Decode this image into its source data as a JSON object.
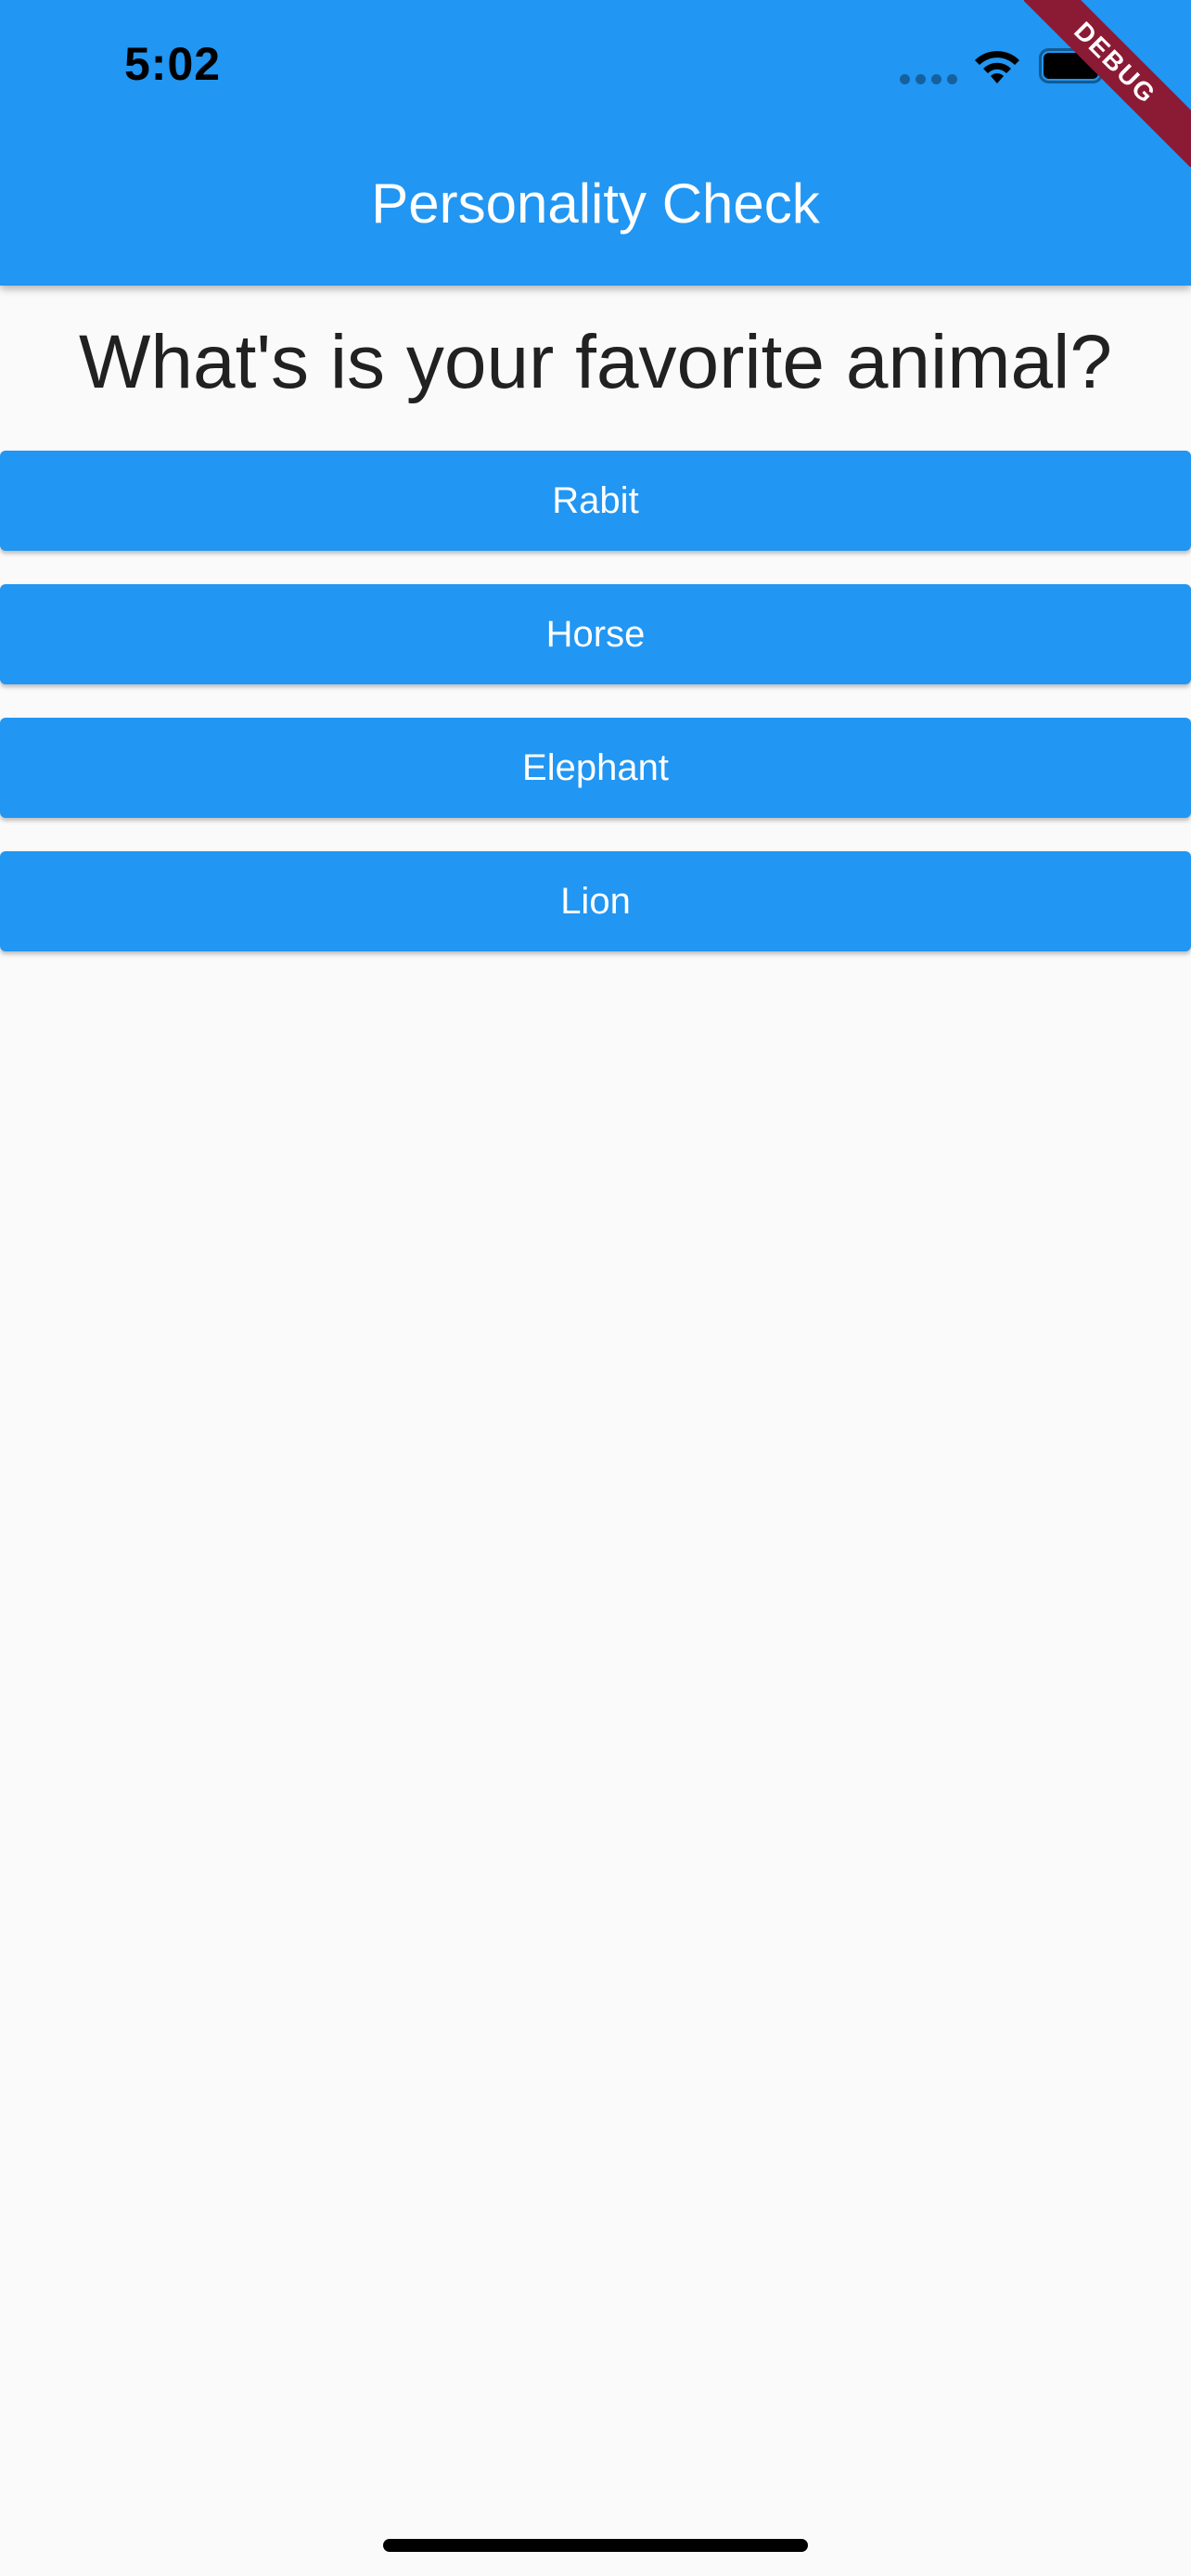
{
  "status_bar": {
    "time": "5:02",
    "icons": [
      "signal-icon",
      "wifi-icon",
      "battery-icon"
    ]
  },
  "app_bar": {
    "title": "Personality Check",
    "color": "#2196f3"
  },
  "debug_banner": {
    "label": "DEBUG",
    "color": "#8b1a35"
  },
  "question": {
    "text": "What's is your favorite animal?"
  },
  "answers": [
    {
      "label": "Rabit"
    },
    {
      "label": "Horse"
    },
    {
      "label": "Elephant"
    },
    {
      "label": "Lion"
    }
  ]
}
